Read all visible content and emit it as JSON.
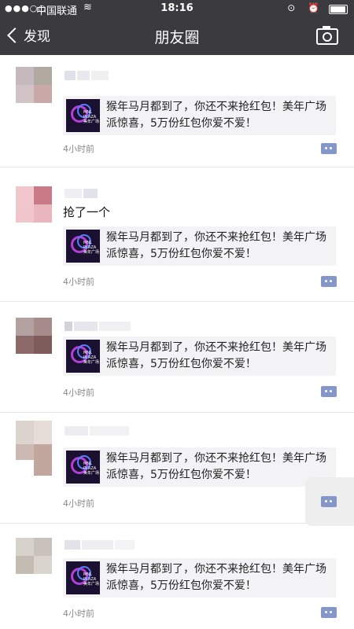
{
  "status_bar": {
    "signal": "●●●○○",
    "carrier": "中国联通",
    "wifi_icon": "wifi-icon",
    "time": "18:16",
    "icons": "⊙ ⏰"
  },
  "nav": {
    "back_label": "发现",
    "title": "朋友圈",
    "camera_icon": "camera-icon"
  },
  "posts": [
    {
      "caption": "",
      "card_text": "猴年马月都到了，你还不来抢红包！美年广场派惊喜，5万份红包你爱不爱！",
      "time": "4小时前"
    },
    {
      "caption": "抢了一个",
      "card_text": "猴年马月都到了，你还不来抢红包！美年广场派惊喜，5万份红包你爱不爱！",
      "time": "4小时前"
    },
    {
      "caption": "",
      "card_text": "猴年马月都到了，你还不来抢红包！美年广场派惊喜，5万份红包你爱不爱！",
      "time": "4小时前"
    },
    {
      "caption": "",
      "card_text": "猴年马月都到了，你还不来抢红包！美年广场派惊喜，5万份红包你爱不爱！",
      "time": "4小时前"
    },
    {
      "caption": "",
      "card_text": "猴年马月都到了，你还不来抢红包！美年广场派惊喜，5万份红包你爱不爱！",
      "time": "4小时前"
    }
  ],
  "thumb_text": "MNL PLAZA 美年广场",
  "colors": {
    "topbar": "#3a3a3f",
    "card_bg": "#f3f3f5",
    "comment_icon": "#8596c9"
  }
}
